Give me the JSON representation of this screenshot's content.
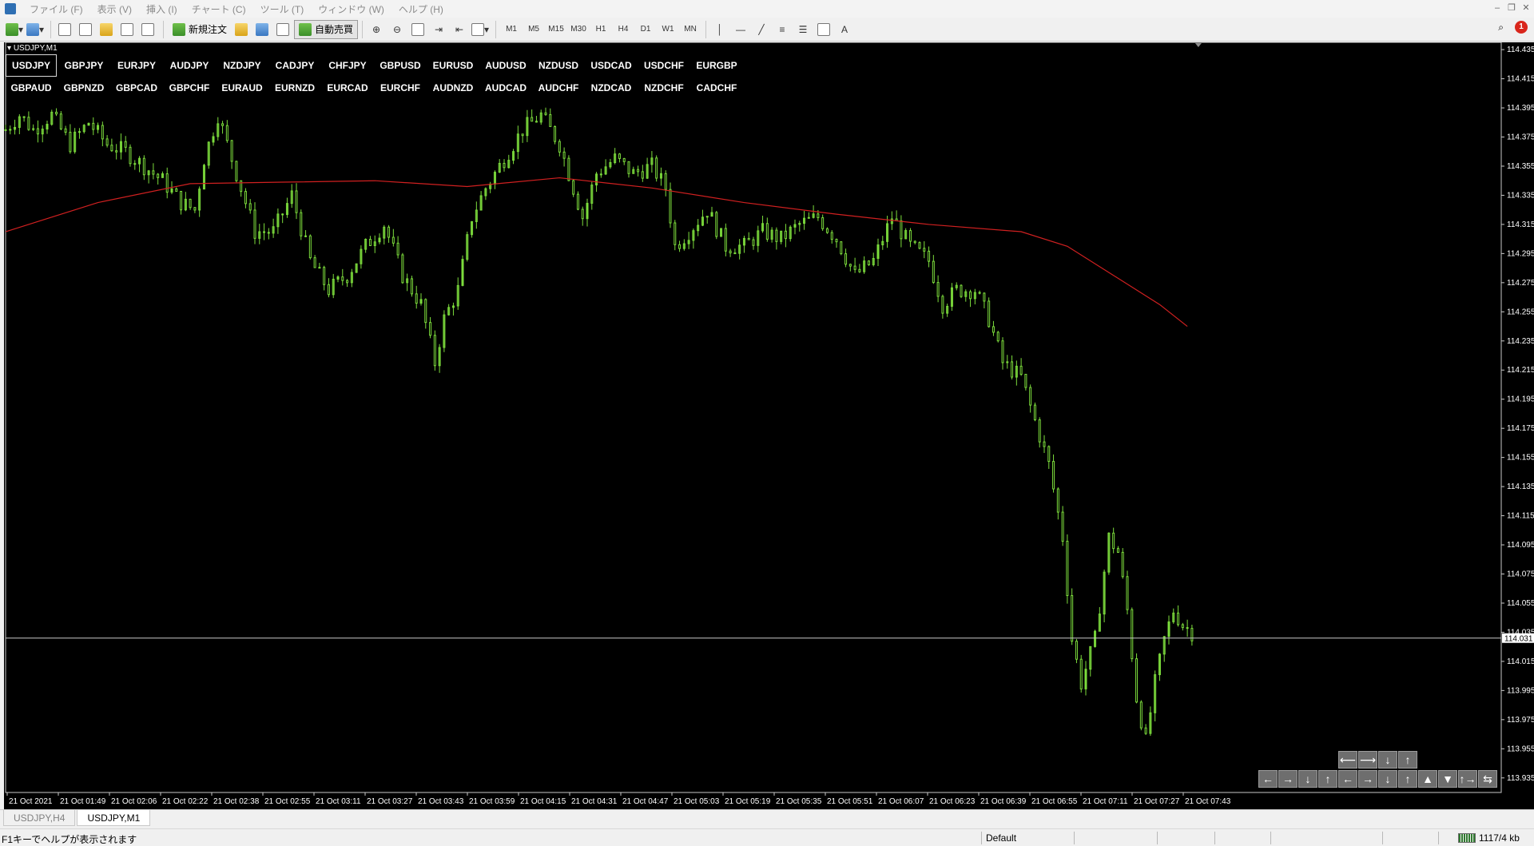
{
  "menu": {
    "items": [
      "ファイル (F)",
      "表示 (V)",
      "挿入 (I)",
      "チャート (C)",
      "ツール (T)",
      "ウィンドウ (W)",
      "ヘルプ (H)"
    ]
  },
  "toolbar": {
    "new_order_label": "新規注文",
    "auto_trade_label": "自動売買",
    "timeframes": [
      "M1",
      "M5",
      "M15",
      "M30",
      "H1",
      "H4",
      "D1",
      "W1",
      "MN"
    ],
    "alert_count": "1",
    "text_tool_label": "A"
  },
  "chart": {
    "window_title": "USDJPY,M1",
    "symbol_row1": [
      "USDJPY",
      "GBPJPY",
      "EURJPY",
      "AUDJPY",
      "NZDJPY",
      "CADJPY",
      "CHFJPY",
      "GBPUSD",
      "EURUSD",
      "AUDUSD",
      "NZDUSD",
      "USDCAD",
      "USDCHF",
      "EURGBP"
    ],
    "symbol_row2": [
      "GBPAUD",
      "GBPNZD",
      "GBPCAD",
      "GBPCHF",
      "EURAUD",
      "EURNZD",
      "EURCAD",
      "EURCHF",
      "AUDNZD",
      "AUDCAD",
      "AUDCHF",
      "NZDCAD",
      "NZDCHF",
      "CADCHF"
    ],
    "active_symbol": "USDJPY",
    "current_price_label": "114.031",
    "colors": {
      "background": "#000000",
      "candles": "#7cdc3c",
      "moving_average": "#d02020",
      "price_line": "#c8c8c8",
      "axis_text": "#ffffff"
    }
  },
  "chart_data": {
    "type": "candlestick",
    "symbol": "USDJPY",
    "timeframe": "M1",
    "y_ticks": [
      "114.435",
      "114.415",
      "114.395",
      "114.375",
      "114.355",
      "114.335",
      "114.315",
      "114.295",
      "114.275",
      "114.255",
      "114.235",
      "114.215",
      "114.195",
      "114.175",
      "114.155",
      "114.135",
      "114.115",
      "114.095",
      "114.075",
      "114.055",
      "114.035",
      "114.015",
      "113.995",
      "113.975",
      "113.955",
      "113.935"
    ],
    "ylim": [
      113.925,
      114.44
    ],
    "x_ticks": [
      "21 Oct 2021",
      "21 Oct 01:49",
      "21 Oct 02:06",
      "21 Oct 02:22",
      "21 Oct 02:38",
      "21 Oct 02:55",
      "21 Oct 03:11",
      "21 Oct 03:27",
      "21 Oct 03:43",
      "21 Oct 03:59",
      "21 Oct 04:15",
      "21 Oct 04:31",
      "21 Oct 04:47",
      "21 Oct 05:03",
      "21 Oct 05:19",
      "21 Oct 05:35",
      "21 Oct 05:51",
      "21 Oct 06:07",
      "21 Oct 06:23",
      "21 Oct 06:39",
      "21 Oct 06:55",
      "21 Oct 07:11",
      "21 Oct 07:27",
      "21 Oct 07:43"
    ],
    "current_price": 114.031,
    "close_path": [
      [
        0,
        114.38
      ],
      [
        1.5,
        114.39
      ],
      [
        3,
        114.38
      ],
      [
        5,
        114.39
      ],
      [
        7,
        114.37
      ],
      [
        9,
        114.385
      ],
      [
        11,
        114.37
      ],
      [
        13,
        114.365
      ],
      [
        15,
        114.355
      ],
      [
        17,
        114.345
      ],
      [
        19,
        114.33
      ],
      [
        20.5,
        114.325
      ],
      [
        21.5,
        114.36
      ],
      [
        23,
        114.39
      ],
      [
        24,
        114.37
      ],
      [
        25.5,
        114.34
      ],
      [
        27,
        114.31
      ],
      [
        29,
        114.31
      ],
      [
        31,
        114.335
      ],
      [
        33,
        114.29
      ],
      [
        35,
        114.27
      ],
      [
        37,
        114.28
      ],
      [
        39,
        114.3
      ],
      [
        41,
        114.315
      ],
      [
        43,
        114.28
      ],
      [
        45,
        114.26
      ],
      [
        46.5,
        114.22
      ],
      [
        47.5,
        114.25
      ],
      [
        49,
        114.27
      ],
      [
        50.5,
        114.32
      ],
      [
        52,
        114.34
      ],
      [
        54,
        114.36
      ],
      [
        56,
        114.38
      ],
      [
        58,
        114.39
      ],
      [
        60,
        114.37
      ],
      [
        61.5,
        114.34
      ],
      [
        62.5,
        114.32
      ],
      [
        64,
        114.35
      ],
      [
        66,
        114.36
      ],
      [
        68,
        114.35
      ],
      [
        70,
        114.355
      ],
      [
        71.5,
        114.34
      ],
      [
        72.5,
        114.3
      ],
      [
        74,
        114.31
      ],
      [
        76,
        114.325
      ],
      [
        78,
        114.3
      ],
      [
        80,
        114.3
      ],
      [
        82,
        114.31
      ],
      [
        84,
        114.305
      ],
      [
        86,
        114.315
      ],
      [
        88,
        114.32
      ],
      [
        90,
        114.305
      ],
      [
        92,
        114.28
      ],
      [
        94,
        114.29
      ],
      [
        96,
        114.32
      ],
      [
        98,
        114.3
      ],
      [
        100,
        114.29
      ],
      [
        101.5,
        114.26
      ],
      [
        103,
        114.27
      ],
      [
        105,
        114.27
      ],
      [
        106.5,
        114.25
      ],
      [
        108,
        114.22
      ],
      [
        110,
        114.21
      ],
      [
        111.5,
        114.18
      ],
      [
        113,
        114.15
      ],
      [
        114.5,
        114.1
      ],
      [
        115.5,
        114.03
      ],
      [
        116.5,
        114.0
      ],
      [
        118,
        114.03
      ],
      [
        119.5,
        114.1
      ],
      [
        120.5,
        114.09
      ],
      [
        121.5,
        114.05
      ],
      [
        122.5,
        113.99
      ],
      [
        123.5,
        113.96
      ],
      [
        124.5,
        114.0
      ],
      [
        125.5,
        114.03
      ],
      [
        126.5,
        114.05
      ],
      [
        127.5,
        114.04
      ],
      [
        128.5,
        114.035
      ]
    ],
    "ma_path": [
      [
        0,
        114.31
      ],
      [
        10,
        114.33
      ],
      [
        20,
        114.343
      ],
      [
        30,
        114.344
      ],
      [
        40,
        114.345
      ],
      [
        50,
        114.341
      ],
      [
        60,
        114.347
      ],
      [
        70,
        114.34
      ],
      [
        80,
        114.33
      ],
      [
        90,
        114.322
      ],
      [
        100,
        114.315
      ],
      [
        110,
        114.31
      ],
      [
        115,
        114.3
      ],
      [
        120,
        114.28
      ],
      [
        125,
        114.26
      ],
      [
        128,
        114.245
      ]
    ],
    "x_domain": [
      0,
      162
    ]
  },
  "nav": {
    "row1": [
      "⟵",
      "⟶",
      "↓",
      "↑"
    ],
    "row2": [
      "←",
      "→",
      "↓",
      "↑",
      "←",
      "→",
      "↓",
      "↑",
      "▲",
      "▼",
      "↑→",
      "⇆"
    ]
  },
  "tabs": [
    "USDJPY,H4",
    "USDJPY,M1"
  ],
  "active_tab": "USDJPY,M1",
  "status": {
    "help": "F1キーでヘルプが表示されます",
    "profile": "Default",
    "traffic": "1117/4 kb"
  }
}
